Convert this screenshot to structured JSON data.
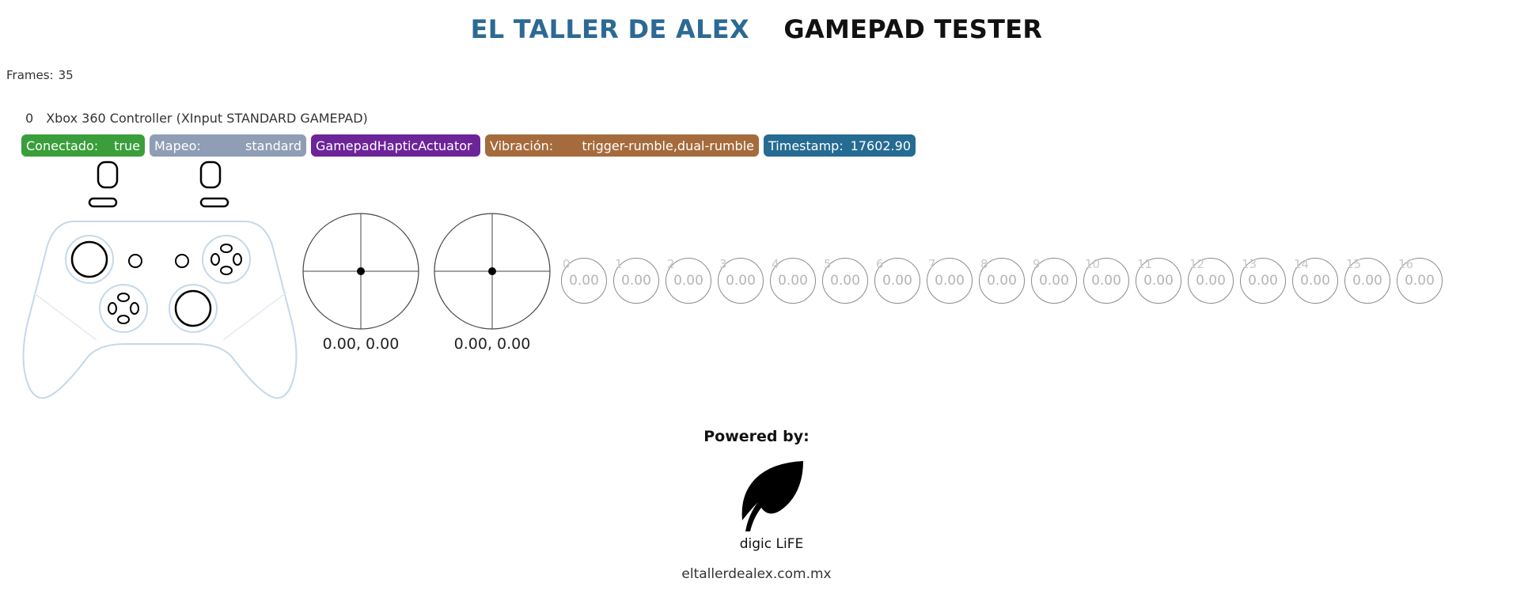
{
  "header": {
    "brand": "EL TALLER DE ALEX",
    "title": "GAMEPAD TESTER"
  },
  "frames": {
    "label": "Frames:",
    "value": "35"
  },
  "gamepad": {
    "index": "0",
    "id": "Xbox 360 Controller (XInput STANDARD GAMEPAD)",
    "badges": {
      "connected": {
        "key": "Conectado:",
        "value": "true"
      },
      "mapping": {
        "key": "Mapeo:",
        "value": "standard"
      },
      "haptic": {
        "label": "GamepadHapticActuator"
      },
      "vibration": {
        "key": "Vibración:",
        "value": "trigger-rumble,dual-rumble"
      },
      "timestamp": {
        "key": "Timestamp:",
        "value": "17602.90"
      }
    },
    "sticks": [
      {
        "value": "0.00, 0.00"
      },
      {
        "value": "0.00, 0.00"
      }
    ],
    "buttons": [
      {
        "index": "0",
        "value": "0.00"
      },
      {
        "index": "1",
        "value": "0.00"
      },
      {
        "index": "2",
        "value": "0.00"
      },
      {
        "index": "3",
        "value": "0.00"
      },
      {
        "index": "4",
        "value": "0.00"
      },
      {
        "index": "5",
        "value": "0.00"
      },
      {
        "index": "6",
        "value": "0.00"
      },
      {
        "index": "7",
        "value": "0.00"
      },
      {
        "index": "8",
        "value": "0.00"
      },
      {
        "index": "9",
        "value": "0.00"
      },
      {
        "index": "10",
        "value": "0.00"
      },
      {
        "index": "11",
        "value": "0.00"
      },
      {
        "index": "12",
        "value": "0.00"
      },
      {
        "index": "13",
        "value": "0.00"
      },
      {
        "index": "14",
        "value": "0.00"
      },
      {
        "index": "15",
        "value": "0.00"
      },
      {
        "index": "16",
        "value": "0.00"
      }
    ]
  },
  "footer": {
    "powered_by": "Powered by:",
    "logo_text": "digic LiFE",
    "site": "eltallerdealex.com.mx"
  },
  "colors": {
    "brand": "#2b6a94",
    "connected": "#3a9e3a",
    "mapping": "#8f9db5",
    "haptic": "#6d2499",
    "vibration": "#a56b3c",
    "timestamp": "#256b92",
    "controller_outline": "#c5d8ea"
  }
}
